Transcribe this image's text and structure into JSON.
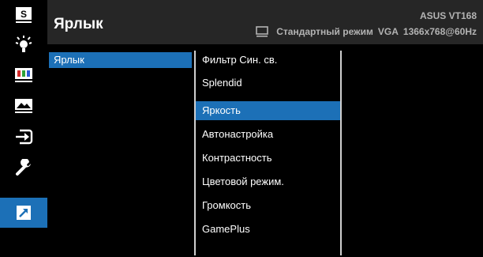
{
  "header": {
    "title": "Ярлык",
    "model": "ASUS VT168",
    "mode": "Стандартный режим",
    "input": "VGA",
    "resolution": "1366x768@60Hz"
  },
  "rail": {
    "icons": [
      "splendid-icon",
      "bluelight-icon",
      "color-icon",
      "image-icon",
      "input-icon",
      "settings-icon",
      "shortcut-icon"
    ],
    "splendid_letter": "S",
    "active_index": 6
  },
  "menu": {
    "section": "Ярлык",
    "options": [
      "Фильтр Син. св.",
      "Splendid",
      "Яркость",
      "Автонастройка",
      "Контрастность",
      "Цветовой режим.",
      "Громкость",
      "GamePlus"
    ],
    "selected_index": 2
  },
  "colors": {
    "accent": "#1c70b7",
    "header_bg": "#262626",
    "screen_bg": "#000000",
    "muted_text": "#b3b3b3"
  }
}
